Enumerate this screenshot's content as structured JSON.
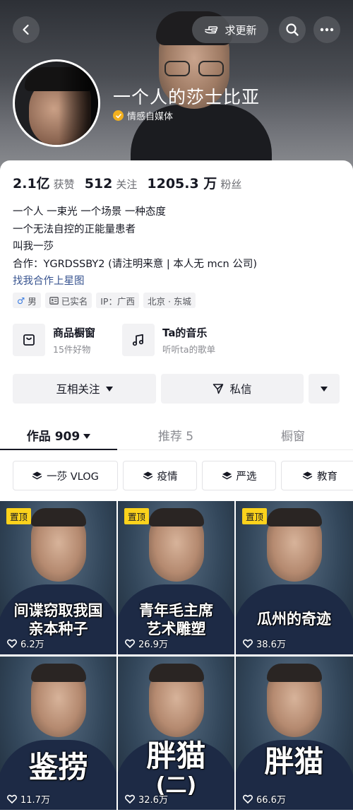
{
  "header": {
    "update_label": "求更新",
    "nickname": "一个人的莎士比亚",
    "verify_label": "情感自媒体"
  },
  "stats": [
    {
      "value": "2.1亿",
      "label": "获赞"
    },
    {
      "value": "512",
      "label": "关注"
    },
    {
      "value": "1205.3 万",
      "label": "粉丝"
    }
  ],
  "bio": {
    "lines": [
      "一个人 一束光 一个场景 一种态度",
      "一个无法自控的正能量患者",
      "叫我一莎",
      "合作：YGRDSSBY2 (请注明来意 | 本人无 mcn 公司)"
    ],
    "link": "找我合作上星图"
  },
  "tags": {
    "gender": "男",
    "gender_symbol": "♂",
    "verified": "已实名",
    "ip": "IP：广西",
    "location": "北京 · 东城"
  },
  "shortcuts": [
    {
      "title": "商品橱窗",
      "subtitle": "15件好物"
    },
    {
      "title": "Ta的音乐",
      "subtitle": "听听ta的歌单"
    }
  ],
  "actions": {
    "follow": "互相关注",
    "message": "私信"
  },
  "tabs": {
    "works": "作品 909",
    "recommend": "推荐 5",
    "shop": "橱窗"
  },
  "categories": [
    "一莎 VLOG",
    "疫情",
    "严选",
    "教育"
  ],
  "videos": [
    {
      "pinned": "置顶",
      "caption_line1": "间谍窃取我国",
      "caption_line2": "亲本种子",
      "likes": "6.2万"
    },
    {
      "pinned": "置顶",
      "caption_line1": "青年毛主席",
      "caption_line2": "艺术雕塑",
      "likes": "26.9万"
    },
    {
      "pinned": "置顶",
      "caption_line1": "瓜州的奇迹",
      "caption_line2": "",
      "likes": "38.6万"
    },
    {
      "caption_line1": "鉴捞",
      "caption_line2": "",
      "likes": "11.7万"
    },
    {
      "caption_line1": "胖猫",
      "caption_line2": "(二)",
      "likes": "32.6万"
    },
    {
      "caption_line1": "胖猫",
      "caption_line2": "",
      "likes": "66.6万"
    }
  ],
  "colors": {
    "link": "#385490",
    "pin_badge": "#fbd21c",
    "verify_badge": "#f2b01e",
    "male_symbol": "#3a7be0"
  }
}
